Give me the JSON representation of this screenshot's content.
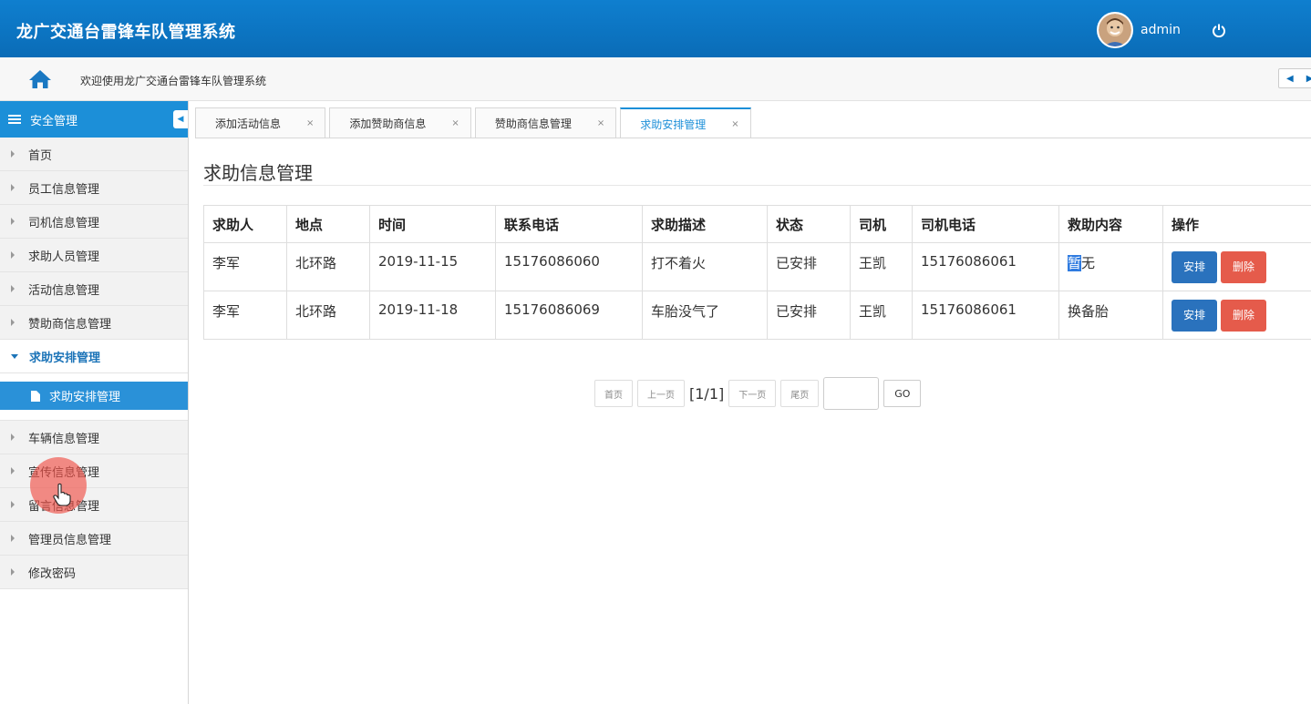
{
  "header": {
    "title": "龙广交通台雷锋车队管理系统",
    "username": "admin"
  },
  "breadcrumb": {
    "text": "欢迎使用龙广交通台雷锋车队管理系统"
  },
  "sidebar": {
    "section_title": "安全管理",
    "items_top": [
      {
        "label": "首页"
      },
      {
        "label": "员工信息管理"
      },
      {
        "label": "司机信息管理"
      },
      {
        "label": "求助人员管理"
      },
      {
        "label": "活动信息管理"
      },
      {
        "label": "赞助商信息管理"
      }
    ],
    "open_item": {
      "label": "求助安排管理"
    },
    "sub_item": {
      "label": "求助安排管理"
    },
    "items_bottom": [
      {
        "label": "车辆信息管理"
      },
      {
        "label": "宣传信息管理"
      },
      {
        "label": "留言信息管理"
      },
      {
        "label": "管理员信息管理"
      },
      {
        "label": "修改密码"
      }
    ]
  },
  "tabs": [
    {
      "label": "添加活动信息",
      "close": "×"
    },
    {
      "label": "添加赞助商信息",
      "close": "×"
    },
    {
      "label": "赞助商信息管理",
      "close": "×"
    },
    {
      "label": "求助安排管理",
      "close": "×",
      "active": true
    }
  ],
  "main": {
    "title": "求助信息管理",
    "columns": [
      "求助人",
      "地点",
      "时间",
      "联系电话",
      "求助描述",
      "状态",
      "司机",
      "司机电话",
      "救助内容",
      "操作"
    ],
    "rows": [
      {
        "requester": "李军",
        "location": "北环路",
        "time": "2019-11-15",
        "phone": "15176086060",
        "description": "打不着火",
        "status": "已安排",
        "driver": "王凯",
        "driver_phone": "15176086061",
        "rescue_sel": "暂",
        "rescue_rest": "无"
      },
      {
        "requester": "李军",
        "location": "北环路",
        "time": "2019-11-18",
        "phone": "15176086069",
        "description": "车胎没气了",
        "status": "已安排",
        "driver": "王凯",
        "driver_phone": "15176086061",
        "rescue_sel": "",
        "rescue_rest": "换备胎"
      }
    ],
    "actions": {
      "arrange": "安排",
      "delete": "删除"
    }
  },
  "pager": {
    "first": "首页",
    "prev": "上一页",
    "info": "[1/1]",
    "next": "下一页",
    "last": "尾页",
    "go": "GO"
  },
  "colors": {
    "header_bg": "#0a6cb7",
    "accent": "#1c8fd8",
    "primary_button": "#2a72bd",
    "danger_button": "#e55b4b"
  }
}
